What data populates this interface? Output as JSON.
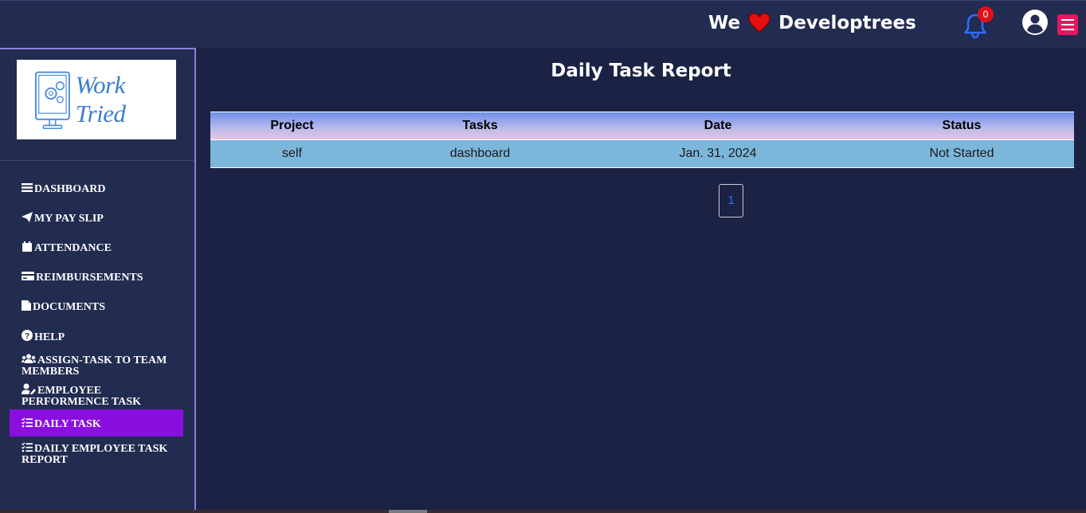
{
  "header": {
    "brand_prefix": "We",
    "brand_name": "Developtrees",
    "notification_count": "0",
    "icons": [
      "heart-icon",
      "bell-icon",
      "user-circle-icon",
      "hamburger-menu-icon"
    ]
  },
  "sidebar": {
    "logo_text": "Work Tried",
    "items": [
      {
        "label": "DASHBOARD",
        "icon": "bars-icon"
      },
      {
        "label": "MY PAY SLIP",
        "icon": "paper-plane-icon"
      },
      {
        "label": "ATTENDANCE",
        "icon": "calendar-icon"
      },
      {
        "label": "REIMBURSEMENTS",
        "icon": "credit-card-icon"
      },
      {
        "label": "DOCUMENTS",
        "icon": "file-icon"
      },
      {
        "label": "HELP",
        "icon": "question-circle-icon"
      },
      {
        "label": "ASSIGN-TASK TO TEAM MEMBERS",
        "icon": "users-icon"
      },
      {
        "label": "EMPLOYEE PERFORMENCE TASK",
        "icon": "user-edit-icon"
      },
      {
        "label": "DAILY TASK",
        "icon": "tasks-icon",
        "active": true
      },
      {
        "label": "DAILY EMPLOYEE TASK REPORT",
        "icon": "tasks-icon"
      }
    ]
  },
  "main": {
    "title": "Daily Task Report",
    "table": {
      "headers": [
        "Project",
        "Tasks",
        "Date",
        "Status"
      ],
      "rows": [
        [
          "self",
          "dashboard",
          "Jan. 31, 2024",
          "Not Started"
        ]
      ]
    },
    "pagination": {
      "current_page": "1"
    }
  },
  "colors": {
    "background": "#1b2244",
    "topbar": "#222b50",
    "active_nav": "#8a0ee0",
    "menu_button": "#e8155f",
    "bell": "#2f6dff",
    "badge": "#e0101a",
    "table_row": "#7db6db"
  }
}
